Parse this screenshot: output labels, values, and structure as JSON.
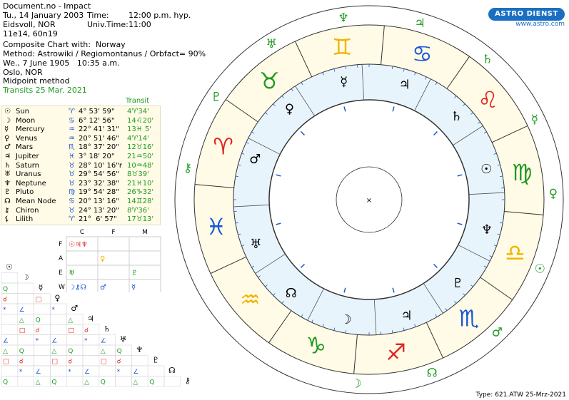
{
  "header": {
    "line1": "Document.no - Impact",
    "line2a": "Tu., 14 January 2003",
    "line2b": "Time:",
    "line2c": "12:00 p.m. hyp.",
    "line3a": "Eidsvoll, NOR",
    "line3b": "Univ.Time:",
    "line3c": "11:00",
    "line4": "11e14, 60n19",
    "line5": "Composite Chart with:  Norway",
    "line6": "Method: Astrowiki / Regiomontanus / Orbfact= 90%",
    "line7": "We., 7 June 1905   10:35 a.m.",
    "line8": "Oslo, NOR",
    "line9": "Midpoint method",
    "line10": "Transits 25 Mar. 2021"
  },
  "logo": {
    "brand": "ASTRO DIENST",
    "url": "www.astro.com"
  },
  "table": {
    "transit_header": "Transit",
    "rows": [
      {
        "glyph": "☉",
        "name": "Sun",
        "sign": "♈",
        "pos": "4° 53' 59\"",
        "tr": "4♈34'"
      },
      {
        "glyph": "☽",
        "name": "Moon",
        "sign": "♋",
        "pos": "6° 12' 56\"",
        "tr": "14♌20'"
      },
      {
        "glyph": "☿",
        "name": "Mercury",
        "sign": "♒",
        "pos": "22° 41' 31\"",
        "tr": "13♓ 5'"
      },
      {
        "glyph": "♀",
        "name": "Venus",
        "sign": "♒",
        "pos": "20° 51' 46\"",
        "tr": "4♈14'"
      },
      {
        "glyph": "♂",
        "name": "Mars",
        "sign": "♏",
        "pos": "18° 37' 20\"",
        "tr": "12♉16'"
      },
      {
        "glyph": "♃",
        "name": "Jupiter",
        "sign": "♓",
        "pos": "3° 18' 20\"",
        "tr": "21♒50'"
      },
      {
        "glyph": "♄",
        "name": "Saturn",
        "sign": "♉",
        "pos": "28° 10' 16\"r",
        "tr": "10♒48'"
      },
      {
        "glyph": "♅",
        "name": "Uranus",
        "sign": "♉",
        "pos": "29° 54' 56\"",
        "tr": "8♉39'"
      },
      {
        "glyph": "♆",
        "name": "Neptune",
        "sign": "♉",
        "pos": "23° 32' 38\"",
        "tr": "21♓10'"
      },
      {
        "glyph": "♇",
        "name": "Pluto",
        "sign": "♍",
        "pos": "19° 54' 28\"",
        "tr": "26♑32'"
      },
      {
        "glyph": "☊",
        "name": "Mean Node",
        "sign": "♋",
        "pos": "20° 13' 16\"",
        "tr": "14♊28'"
      },
      {
        "glyph": "⚷",
        "name": "Chiron",
        "sign": "♉",
        "pos": "24° 13' 20\"",
        "tr": "8♈36'"
      },
      {
        "glyph": "⚸",
        "name": "Lilith",
        "sign": "♈",
        "pos": "21°  6' 57\"",
        "tr": "17♉13'"
      }
    ]
  },
  "elements": {
    "cols": [
      "C",
      "F",
      "M"
    ],
    "rows": [
      "F",
      "A",
      "E",
      "W"
    ],
    "cells": [
      [
        "☉♃♆",
        "",
        ""
      ],
      [
        "",
        "♀",
        ""
      ],
      [
        "♅",
        "",
        "♇"
      ],
      [
        "☽⚷☊",
        "♂",
        "☿"
      ]
    ]
  },
  "aspect_glyphs": [
    "☉",
    "☽",
    "☿",
    "♀",
    "♂",
    "♃",
    "♄",
    "♅",
    "♆",
    "♇",
    "☊",
    "⚷"
  ],
  "chart_data": {
    "type": "wheel",
    "signs": [
      "♈",
      "♉",
      "♊",
      "♋",
      "♌",
      "♍",
      "♎",
      "♏",
      "♐",
      "♑",
      "♒",
      "♓"
    ],
    "sign_colors": [
      "#e0261f",
      "#1f9a1f",
      "#f0b400",
      "#1a56d6",
      "#e0261f",
      "#1f9a1f",
      "#f0b400",
      "#1a56d6",
      "#e0261f",
      "#1f9a1f",
      "#f0b400",
      "#1a56d6"
    ],
    "transit_glyphs": [
      "⚷",
      "♇",
      "♅",
      "♆",
      "♃",
      "♄",
      "☿",
      "♀",
      "☉",
      "♂",
      "☊",
      "☽"
    ],
    "inner_glyphs": [
      "♂",
      "♀",
      "☿",
      "♃",
      "♄",
      "☉",
      "♆",
      "♇",
      "♃",
      "☽",
      "☊",
      "♅"
    ],
    "center_mark": "×"
  },
  "footer": {
    "type_label": "Type: 621.ATW  25-Mrz-2021"
  }
}
